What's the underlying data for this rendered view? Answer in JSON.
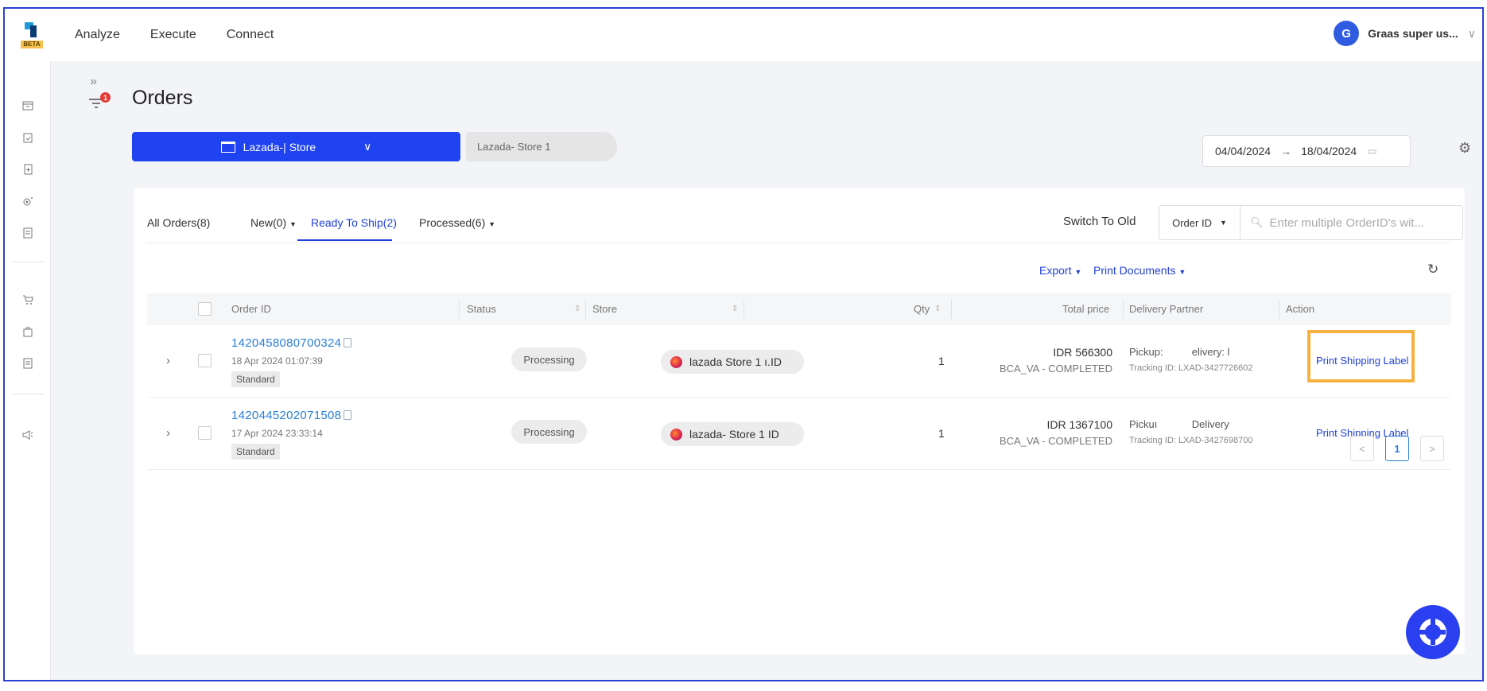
{
  "app": {
    "beta_label": "BETA"
  },
  "nav": {
    "items": [
      "Analyze",
      "Execute",
      "Connect"
    ]
  },
  "user": {
    "avatar_letter": "G",
    "name": "Graas super us..."
  },
  "rail": {
    "filter_badge": "1"
  },
  "page": {
    "title": "Orders"
  },
  "store_selector": {
    "label": "Lazada-| Store",
    "chip_label": "Lazada- Store 1"
  },
  "date_range": {
    "start": "04/04/2024",
    "separator": "→",
    "end": "18/04/2024"
  },
  "tabs": [
    {
      "label": "All Orders(8)",
      "dropdown": false
    },
    {
      "label": "New(0)",
      "dropdown": true
    },
    {
      "label": "Ready To Ship(2)",
      "active": true
    },
    {
      "label": "Processed(6)",
      "dropdown": true
    }
  ],
  "toolbar": {
    "switch_old": "Switch To Old",
    "search_type": "Order ID",
    "search_placeholder": "Enter multiple OrderID's wit...",
    "export": "Export",
    "print_documents": "Print Documents"
  },
  "table": {
    "columns": [
      "Order ID",
      "Status",
      "Store",
      "Qty",
      "Total price",
      "Delivery Partner",
      "Action"
    ],
    "rows": [
      {
        "order_id": "1420458080700324",
        "date": "18 Apr 2024 01:07:39",
        "tag": "Standard",
        "status": "Processing",
        "store": "lazada Store 1 ı.ID",
        "qty": "1",
        "price": "IDR 566300",
        "payment": "BCA_VA - COMPLETED",
        "pickup": "Pickup:          elivery: l",
        "tracking": "Tracking ID: LXAD-3427726602",
        "action": "Print Shipping Label",
        "highlighted": true
      },
      {
        "order_id": "1420445202071508",
        "date": "17 Apr 2024 23:33:14",
        "tag": "Standard",
        "status": "Processing",
        "store": "lazada- Store 1  ID",
        "qty": "1",
        "price": "IDR 1367100",
        "payment": "BCA_VA - COMPLETED",
        "pickup": "Pickuı            Delivery",
        "tracking": "Tracking ID: LXAD-3427698700",
        "action": "Print Shipping Label",
        "highlighted": false
      }
    ]
  },
  "pagination": {
    "prev": "<",
    "current": "1",
    "next": ">"
  },
  "colors": {
    "primary": "#1f43f0",
    "link": "#2140d8",
    "highlight": "#f6b23e",
    "badge": "#e53935"
  }
}
